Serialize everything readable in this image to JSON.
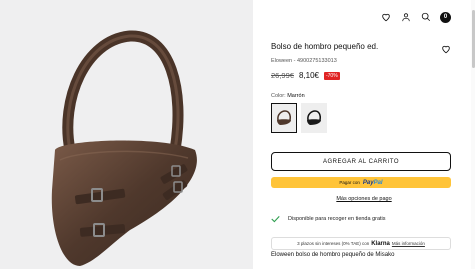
{
  "header": {
    "icons": [
      "heart-icon",
      "user-icon",
      "search-icon",
      "cart-icon"
    ],
    "cart_count": "0"
  },
  "product": {
    "title": "Bolso de hombro pequeño ed.",
    "reference": "Eloween - 4900275133013",
    "old_price": "26,99€",
    "new_price": "8,10€",
    "discount": "-70%",
    "color_label": "Color: ",
    "color_value": "Marrón"
  },
  "actions": {
    "add_to_cart": "AGREGAR AL CARRITO",
    "paypal_prefix": "Pagar con",
    "paypal_brand_a": "Pay",
    "paypal_brand_b": "Pal",
    "more_payment": "Más opciones de pago"
  },
  "pickup": {
    "text": "Disponible para recoger en tienda gratis"
  },
  "klarna": {
    "prefix": "3 plazos sin intereses (0% TAE) con",
    "brand": "Klarna",
    "link": "Más información"
  },
  "description": {
    "title": "Eloween bolso de hombro pequeño de Misako"
  },
  "colors": {
    "accent": "#111111",
    "paypal": "#ffc439",
    "discount": "#e02424",
    "check": "#2e9e4f",
    "bag_brown": "#5a3e30"
  }
}
